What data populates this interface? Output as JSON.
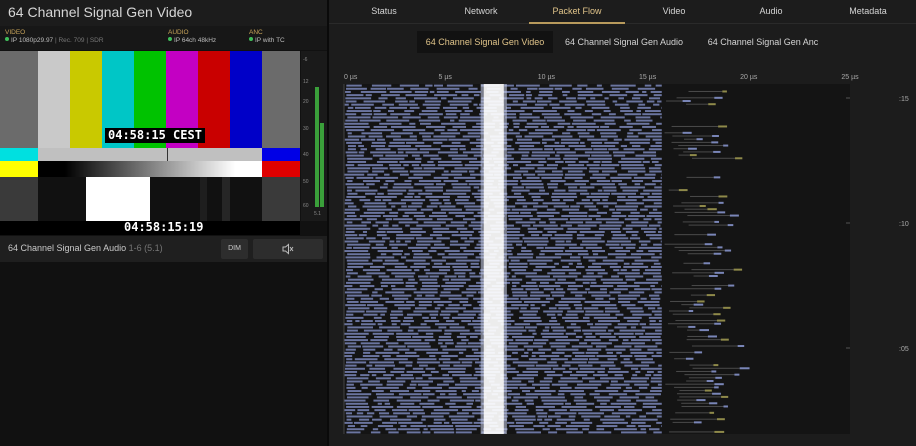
{
  "window": {
    "title": "64 Channel Signal Gen Video"
  },
  "meta": {
    "video": {
      "label": "VIDEO",
      "value": "IP 1080p29.97",
      "extra1": "Rec. 709",
      "extra2": "SDR"
    },
    "audio": {
      "label": "AUDIO",
      "value": "IP 64ch 48kHz"
    },
    "anc": {
      "label": "ANC",
      "value": "IP with TC"
    }
  },
  "video": {
    "timecode_overlay": "04:58:15 CEST",
    "timecode_bottom": "04:58:15:19"
  },
  "meter": {
    "ticks": [
      "-6",
      "12",
      "20",
      "30",
      "40",
      "50",
      "60"
    ],
    "footer": "5.1"
  },
  "audio_row": {
    "label": "64 Channel Signal Gen Audio",
    "channels": "1-6 (5.1)",
    "dim_label": "DIM",
    "mute_icon": "speaker-muted-icon"
  },
  "tabs": [
    "Status",
    "Network",
    "Packet Flow",
    "Video",
    "Audio",
    "Metadata"
  ],
  "active_tab": "Packet Flow",
  "subtabs": [
    "64 Channel Signal Gen Video",
    "64 Channel Signal Gen Audio",
    "64 Channel Signal Gen Anc"
  ],
  "active_subtab": "64 Channel Signal Gen Video",
  "chart_data": {
    "type": "scatter",
    "x_ticks": [
      "0 µs",
      "5 µs",
      "10 µs",
      "15 µs",
      "20 µs",
      "25 µs"
    ],
    "xlim": [
      0,
      25
    ],
    "y_ticks": [
      ":15",
      ":10",
      ":05"
    ],
    "grid": false,
    "colors": {
      "packets": "#7a86b8",
      "late_packets": "#8f8a4a",
      "dense_band": "#ffffff",
      "background": "#141414"
    }
  }
}
